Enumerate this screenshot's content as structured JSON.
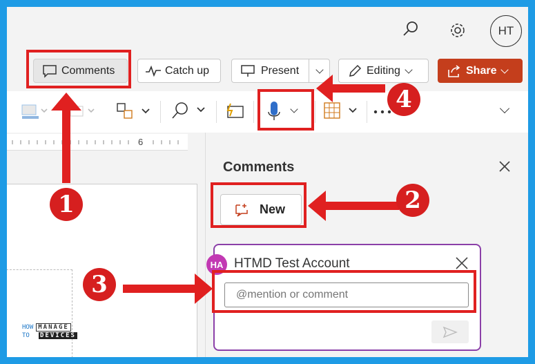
{
  "topbar": {
    "search_icon": "search-icon",
    "settings_icon": "gear-icon",
    "avatar_initials": "HT"
  },
  "actions": {
    "comments_label": "Comments",
    "catchup_label": "Catch up",
    "present_label": "Present",
    "editing_label": "Editing",
    "share_label": "Share"
  },
  "ruler": {
    "mark_label": "6"
  },
  "comments_pane": {
    "title": "Comments",
    "new_label": "New",
    "card": {
      "author_initials": "HA",
      "author_name": "HTMD Test Account",
      "placeholder": "@mention or comment"
    }
  },
  "annotations": {
    "step1": "1",
    "step2": "2",
    "step3": "3",
    "step4": "4"
  },
  "watermark": {
    "line1_left": "HOW",
    "line1_right": "MANAGE",
    "line2_left": "TO",
    "line2_right": "DEVICES"
  },
  "colors": {
    "accent_red": "#e02020",
    "share_bg": "#c43e1c",
    "card_border": "#8b3fa8",
    "avatar_bg": "#c239b3",
    "frame_blue": "#1e9be5"
  }
}
